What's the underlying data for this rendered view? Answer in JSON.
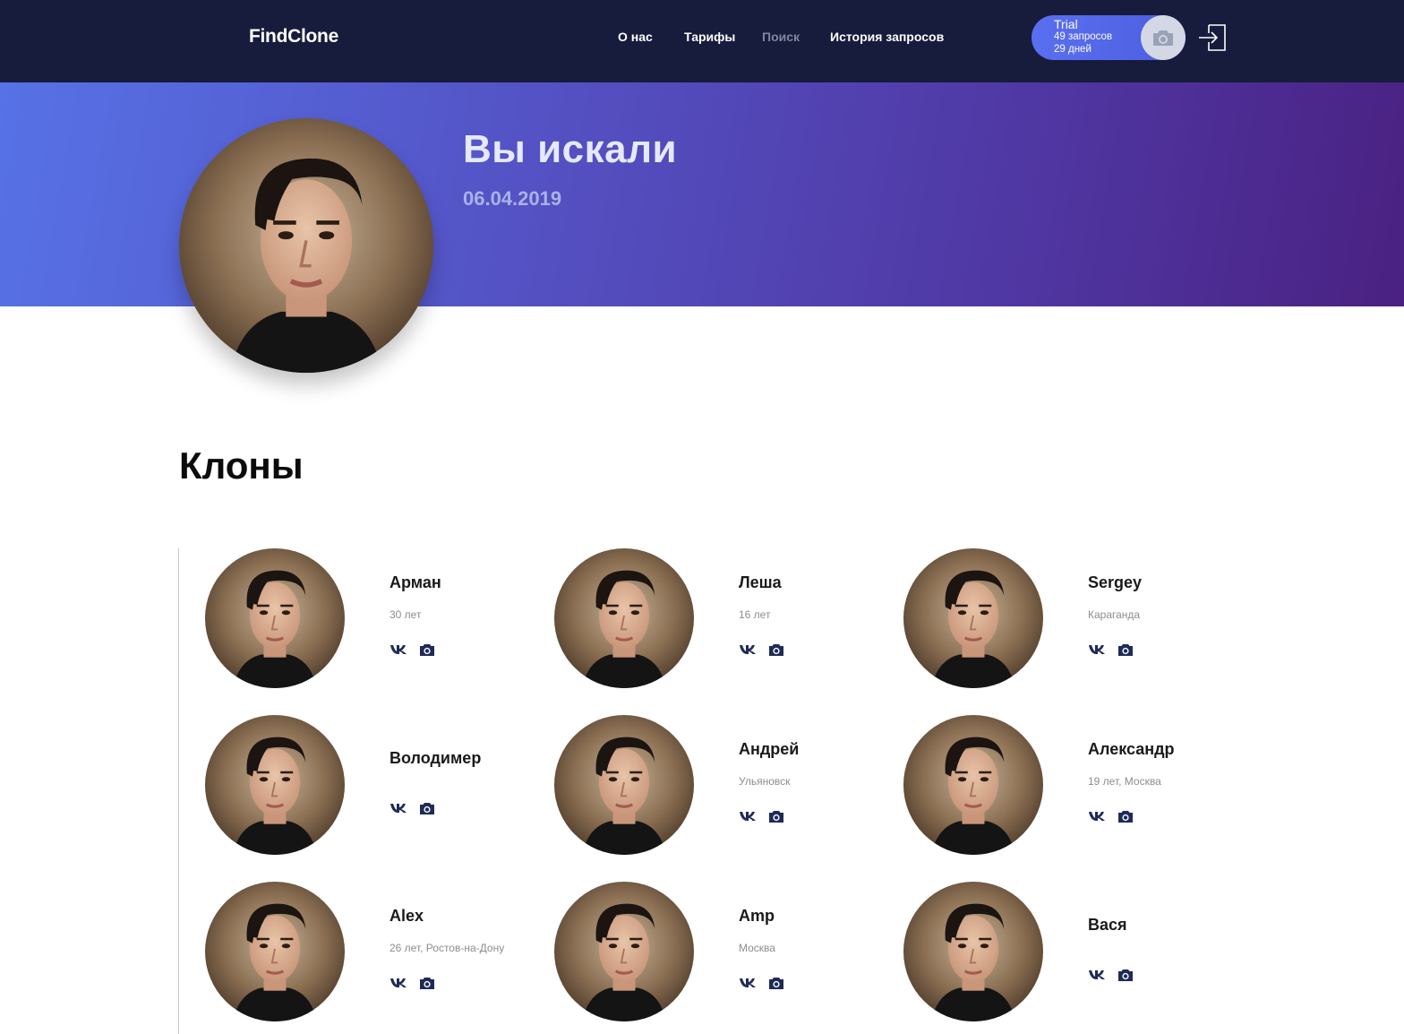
{
  "header": {
    "logo": "FindClone",
    "nav": [
      {
        "label": "О нас",
        "active": false
      },
      {
        "label": "Тарифы",
        "active": false
      },
      {
        "label": "Поиск",
        "active": true
      },
      {
        "label": "История запросов",
        "active": false
      }
    ],
    "plan": {
      "title": "Trial",
      "requests": "49 запросов",
      "days": "29 дней",
      "icon": "camera-icon"
    },
    "logout_icon": "logout-icon"
  },
  "hero": {
    "title": "Вы искали",
    "date": "06.04.2019"
  },
  "clones": {
    "title": "Клоны",
    "items": [
      {
        "name": "Арман",
        "meta": "30 лет"
      },
      {
        "name": "Леша",
        "meta": "16 лет"
      },
      {
        "name": "Sergey",
        "meta": "Караганда"
      },
      {
        "name": "Володимер",
        "meta": ""
      },
      {
        "name": "Андрей",
        "meta": "Ульяновск"
      },
      {
        "name": "Александр",
        "meta": "19 лет, Москва"
      },
      {
        "name": "Alex",
        "meta": "26 лет, Ростов-на-Дону"
      },
      {
        "name": "Amp",
        "meta": "Москва"
      },
      {
        "name": "Вася",
        "meta": ""
      }
    ]
  },
  "colors": {
    "nav_bg": "#171b3c",
    "accent": "#5a6ff0",
    "icon": "#1f2b57"
  }
}
